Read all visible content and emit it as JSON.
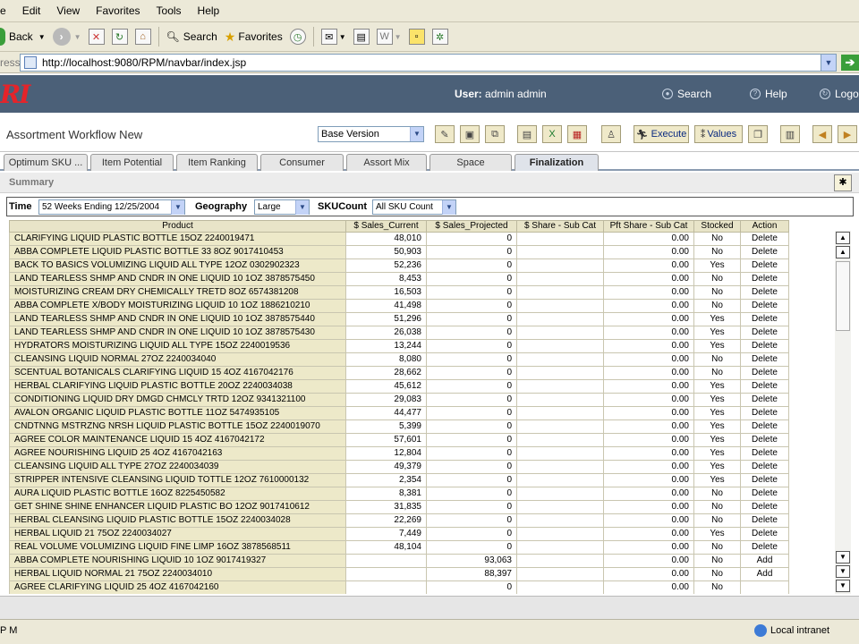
{
  "menubar": {
    "items": [
      "e",
      "Edit",
      "View",
      "Favorites",
      "Tools",
      "Help"
    ]
  },
  "toolbar": {
    "back": "Back",
    "search": "Search",
    "favorites": "Favorites"
  },
  "address": {
    "label": "ress",
    "url": "http://localhost:9080/RPM/navbar/index.jsp"
  },
  "banner": {
    "logo_text": "RI",
    "user_label": "User:",
    "user_name": "admin admin",
    "nav": {
      "search": "Search",
      "help": "Help",
      "logout": "Logou"
    }
  },
  "workflow": {
    "title": "Assortment Workflow New",
    "version": "Base Version",
    "execute_label": "Execute",
    "values_label": "Values"
  },
  "tabs": [
    "Optimum SKU ...",
    "Item Potential",
    "Item Ranking",
    "Consumer",
    "Assort Mix",
    "Space",
    "Finalization"
  ],
  "active_tab": 6,
  "summary_title": "Summary",
  "filters": {
    "time_label": "Time",
    "time_value": "52 Weeks Ending 12/25/2004",
    "geo_label": "Geography",
    "geo_value": "Large",
    "sku_label": "SKUCount",
    "sku_value": "All SKU Count"
  },
  "grid": {
    "columns": [
      "Product",
      "$ Sales_Current",
      "$ Sales_Projected",
      "$ Share - Sub Cat",
      "Pft Share - Sub Cat",
      "Stocked",
      "Action"
    ],
    "rows": [
      [
        "CLARIFYING LIQUID PLASTIC BOTTLE 15OZ 2240019471",
        "48,010",
        "0",
        "",
        "0.00",
        "No",
        "Delete"
      ],
      [
        "ABBA COMPLETE LIQUID PLASTIC BOTTLE 33 8OZ 9017410453",
        "50,903",
        "0",
        "",
        "0.00",
        "No",
        "Delete"
      ],
      [
        "BACK TO BASICS VOLUMIZING LIQUID ALL TYPE 12OZ 0302902323",
        "52,236",
        "0",
        "",
        "0.00",
        "Yes",
        "Delete"
      ],
      [
        "LAND TEARLESS SHMP AND CNDR IN ONE LIQUID 10 1OZ 3878575450",
        "8,453",
        "0",
        "",
        "0.00",
        "No",
        "Delete"
      ],
      [
        "MOISTURIZING CREAM DRY CHEMICALLY TRETD 8OZ 6574381208",
        "16,503",
        "0",
        "",
        "0.00",
        "No",
        "Delete"
      ],
      [
        "ABBA COMPLETE X/BODY MOISTURIZING LIQUID 10 1OZ 1886210210",
        "41,498",
        "0",
        "",
        "0.00",
        "No",
        "Delete"
      ],
      [
        "LAND TEARLESS SHMP AND CNDR IN ONE LIQUID 10 1OZ 3878575440",
        "51,296",
        "0",
        "",
        "0.00",
        "Yes",
        "Delete"
      ],
      [
        "LAND TEARLESS SHMP AND CNDR IN ONE LIQUID 10 1OZ 3878575430",
        "26,038",
        "0",
        "",
        "0.00",
        "Yes",
        "Delete"
      ],
      [
        "HYDRATORS MOISTURIZING LIQUID ALL TYPE 15OZ 2240019536",
        "13,244",
        "0",
        "",
        "0.00",
        "Yes",
        "Delete"
      ],
      [
        "CLEANSING LIQUID NORMAL 27OZ 2240034040",
        "8,080",
        "0",
        "",
        "0.00",
        "No",
        "Delete"
      ],
      [
        "SCENTUAL BOTANICALS CLARIFYING LIQUID 15 4OZ 4167042176",
        "28,662",
        "0",
        "",
        "0.00",
        "No",
        "Delete"
      ],
      [
        "HERBAL CLARIFYING LIQUID PLASTIC BOTTLE 20OZ 2240034038",
        "45,612",
        "0",
        "",
        "0.00",
        "Yes",
        "Delete"
      ],
      [
        "CONDITIONING LIQUID DRY DMGD CHMCLY TRTD 12OZ 9341321100",
        "29,083",
        "0",
        "",
        "0.00",
        "Yes",
        "Delete"
      ],
      [
        "AVALON ORGANIC LIQUID PLASTIC BOTTLE 11OZ 5474935105",
        "44,477",
        "0",
        "",
        "0.00",
        "Yes",
        "Delete"
      ],
      [
        "CNDTNNG MSTRZNG NRSH LIQUID PLASTIC BOTTLE 15OZ 2240019070",
        "5,399",
        "0",
        "",
        "0.00",
        "Yes",
        "Delete"
      ],
      [
        "AGREE COLOR MAINTENANCE LIQUID 15 4OZ 4167042172",
        "57,601",
        "0",
        "",
        "0.00",
        "Yes",
        "Delete"
      ],
      [
        "AGREE NOURISHING LIQUID 25 4OZ 4167042163",
        "12,804",
        "0",
        "",
        "0.00",
        "Yes",
        "Delete"
      ],
      [
        "CLEANSING LIQUID ALL TYPE 27OZ 2240034039",
        "49,379",
        "0",
        "",
        "0.00",
        "Yes",
        "Delete"
      ],
      [
        "STRIPPER INTENSIVE CLEANSING LIQUID TOTTLE 12OZ 7610000132",
        "2,354",
        "0",
        "",
        "0.00",
        "Yes",
        "Delete"
      ],
      [
        "AURA LIQUID PLASTIC BOTTLE 16OZ 8225450582",
        "8,381",
        "0",
        "",
        "0.00",
        "No",
        "Delete"
      ],
      [
        "GET SHINE SHINE ENHANCER LIQUID PLASTIC BO 12OZ 9017410612",
        "31,835",
        "0",
        "",
        "0.00",
        "No",
        "Delete"
      ],
      [
        "HERBAL CLEANSING LIQUID PLASTIC BOTTLE 15OZ 2240034028",
        "22,269",
        "0",
        "",
        "0.00",
        "No",
        "Delete"
      ],
      [
        "HERBAL LIQUID 21 75OZ 2240034027",
        "7,449",
        "0",
        "",
        "0.00",
        "Yes",
        "Delete"
      ],
      [
        "REAL VOLUME VOLUMIZING LIQUID FINE LIMP 16OZ 3878568511",
        "48,104",
        "0",
        "",
        "0.00",
        "No",
        "Delete"
      ],
      [
        "ABBA COMPLETE NOURISHING LIQUID 10 1OZ 9017419327",
        "",
        "93,063",
        "",
        "0.00",
        "No",
        "Add"
      ],
      [
        "HERBAL LIQUID NORMAL 21 75OZ 2240034010",
        "",
        "88,397",
        "",
        "0.00",
        "No",
        "Add"
      ],
      [
        "AGREE CLARIFYING LIQUID 25 4OZ 4167042160",
        "",
        "0",
        "",
        "0.00",
        "No",
        ""
      ]
    ]
  },
  "status": {
    "left": "P M",
    "zone": "Local intranet"
  }
}
